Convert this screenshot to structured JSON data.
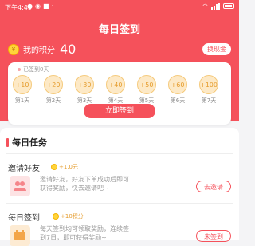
{
  "status_bar": {
    "time": "下午4:49"
  },
  "header": {
    "title": "每日签到",
    "points_label": "我的积分",
    "points_value": "40",
    "exchange_label": "换现金"
  },
  "checkin": {
    "signed_days_label": "已签到0天",
    "days": [
      {
        "reward": "+10",
        "label": "第1天"
      },
      {
        "reward": "+20",
        "label": "第2天"
      },
      {
        "reward": "+30",
        "label": "第3天"
      },
      {
        "reward": "+40",
        "label": "第4天"
      },
      {
        "reward": "+50",
        "label": "第5天"
      },
      {
        "reward": "+60",
        "label": "第6天"
      },
      {
        "reward": "+100",
        "label": "第7天"
      }
    ],
    "sign_button": "立即签到"
  },
  "tasks": {
    "title": "每日任务",
    "items": [
      {
        "name": "邀请好友",
        "reward": "+1.0元",
        "desc_line1": "邀请好友，好友下单成功后即可",
        "desc_line2": "获得奖励，快去邀请吧~",
        "button": "去邀请",
        "icon": "group-icon"
      },
      {
        "name": "每日签到",
        "reward": "+10积分",
        "desc_line1": "每天签到均可领取奖励，连续签",
        "desc_line2": "到7日，即可获得奖励~",
        "button": "未签到",
        "icon": "calendar-icon"
      }
    ]
  },
  "colors": {
    "accent": "#f5515b",
    "gold": "#e59c2d"
  }
}
